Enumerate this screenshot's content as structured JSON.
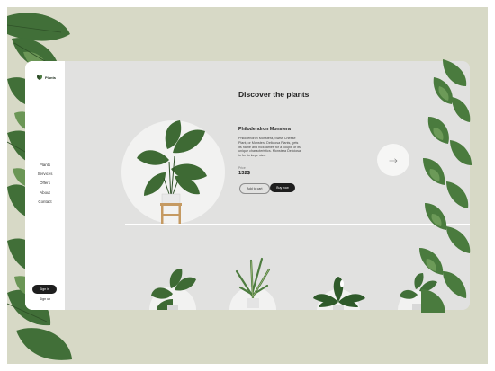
{
  "app": {
    "logo_text": "Plants"
  },
  "sidebar": {
    "nav": [
      "Plants",
      "Services",
      "Offers",
      "About",
      "Contact"
    ],
    "signin_label": "Sign in",
    "signup_label": "Sign up"
  },
  "main": {
    "title": "Discover the plants",
    "product": {
      "name": "Philodendron Monstera",
      "description": "Philodendron Monstera, Swiss Cheese Plant, or Monstera Deliciosa Plants, gets its name and nicknames for a couple of its unique characteristics. Monstera Deliciosa is for its large size.",
      "price_label": "Price",
      "price_value": "132$",
      "add_to_cart_label": "Add to cart",
      "buy_now_label": "Buy now"
    },
    "thumbnails": [
      "monstera-plant",
      "dracaena-plant",
      "peace-lily-plant",
      "monstera-plant-small"
    ]
  },
  "colors": {
    "page_background": "#d7d9c6",
    "card_background": "#e1e1e0",
    "leaf_dark": "#3f6b37",
    "leaf_mid": "#5c8a4a",
    "button_dark": "#1e1e1e"
  }
}
